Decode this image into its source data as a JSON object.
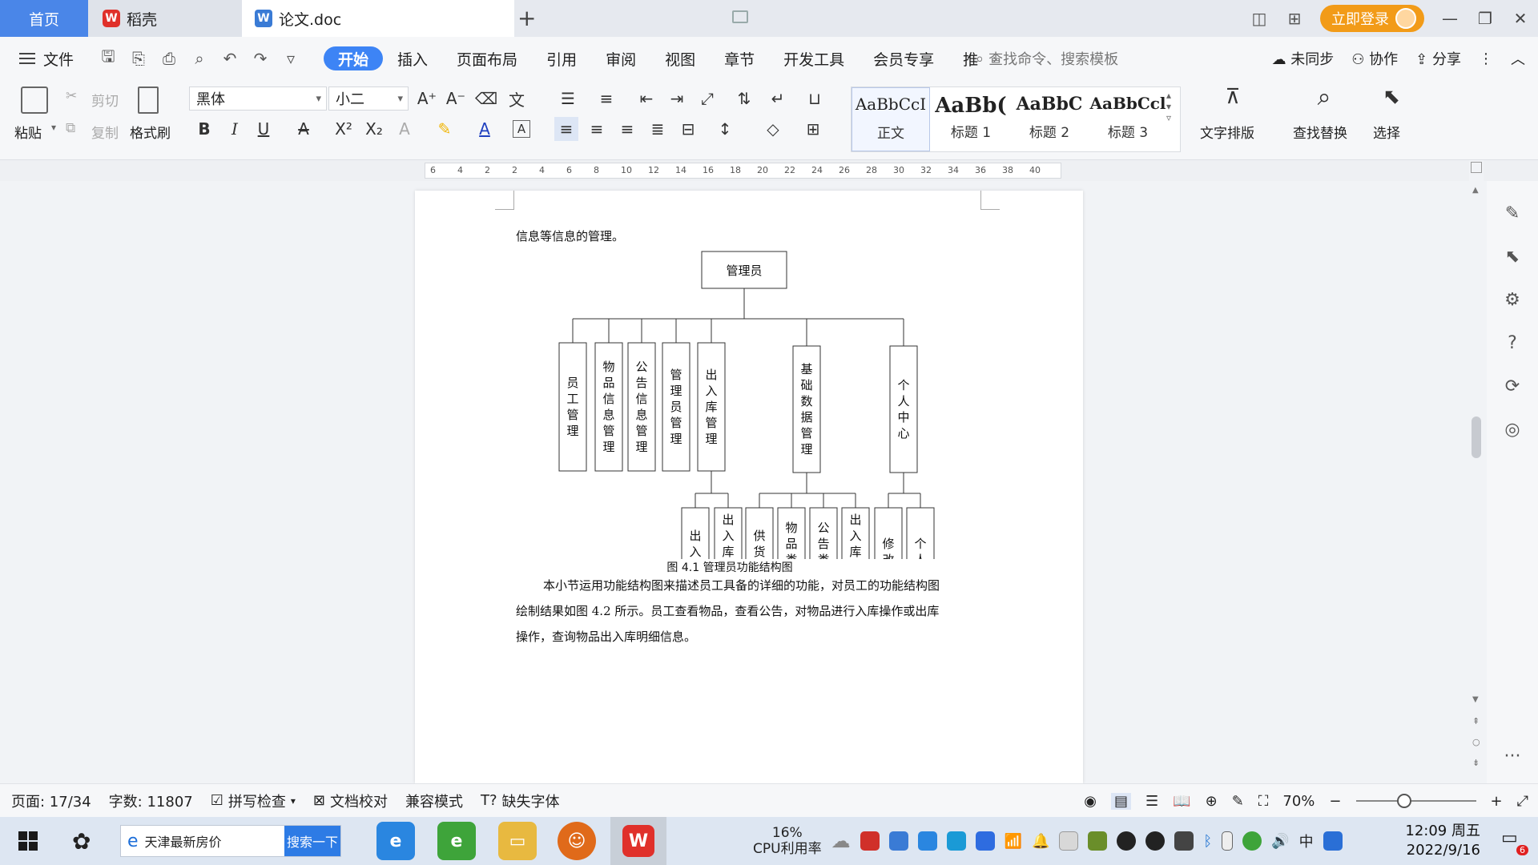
{
  "titlebar": {
    "tabs": [
      {
        "label": "首页"
      },
      {
        "label": "稻壳"
      },
      {
        "label": "论文.doc"
      }
    ],
    "login_label": "立即登录"
  },
  "menubar": {
    "file_label": "文件",
    "tabs": [
      "开始",
      "插入",
      "页面布局",
      "引用",
      "审阅",
      "视图",
      "章节",
      "开发工具",
      "会员专享",
      "推"
    ],
    "search_placeholder": "查找命令、搜索模板",
    "sync_label": "未同步",
    "collab_label": "协作",
    "share_label": "分享"
  },
  "ribbon": {
    "paste": "粘贴",
    "cut": "剪切",
    "copy": "复制",
    "format_painter": "格式刷",
    "font_name": "黑体",
    "font_size": "小二",
    "styles": [
      {
        "preview": "AaBbCcI",
        "label": "正文"
      },
      {
        "preview": "AaBb(",
        "label": "标题 1"
      },
      {
        "preview": "AaBbC",
        "label": "标题 2"
      },
      {
        "preview": "AaBbCcl",
        "label": "标题 3"
      }
    ],
    "text_layout": "文字排版",
    "find_replace": "查找替换",
    "select": "选择"
  },
  "ruler": {
    "ticks": [
      "6",
      "4",
      "2",
      "2",
      "4",
      "6",
      "8",
      "10",
      "12",
      "14",
      "16",
      "18",
      "20",
      "22",
      "24",
      "26",
      "28",
      "30",
      "32",
      "34",
      "36",
      "38",
      "40"
    ]
  },
  "document": {
    "para_top": "信息等信息的管理。",
    "chart": {
      "root": "管理员",
      "level1": [
        "员工管理",
        "物品信息管理",
        "公告信息管理",
        "管理员管理",
        "出入库管理",
        "基础数据管理",
        "个人中心"
      ],
      "children_crk": [
        "出入库管理",
        "出入库列表管理"
      ],
      "children_basic": [
        "供货方管理",
        "物品类型管理",
        "公告类型管理",
        "出入库类型管理"
      ],
      "children_personal": [
        "修改密码",
        "个人信息"
      ]
    },
    "caption": "图 4.1 管理员功能结构图",
    "para_lines": [
      "本小节运用功能结构图来描述员工具备的详细的功能，对员工的功能结构图",
      "绘制结果如图 4.2 所示。员工查看物品，查看公告，对物品进行入库操作或出库",
      "操作，查询物品出入库明细信息。"
    ]
  },
  "statusbar": {
    "page": "页面: 17/34",
    "words": "字数: 11807",
    "spell": "拼写检查",
    "proof": "文档校对",
    "compat": "兼容模式",
    "missing_font": "缺失字体",
    "zoom": "70%",
    "zoom_fraction": 0.4
  },
  "taskbar": {
    "search_text": "天津最新房价",
    "search_button": "搜索一下",
    "cpu_percent": "16%",
    "cpu_label": "CPU利用率",
    "ime": "中",
    "time": "12:09 周五",
    "date": "2022/9/16",
    "notif_count": "6"
  }
}
